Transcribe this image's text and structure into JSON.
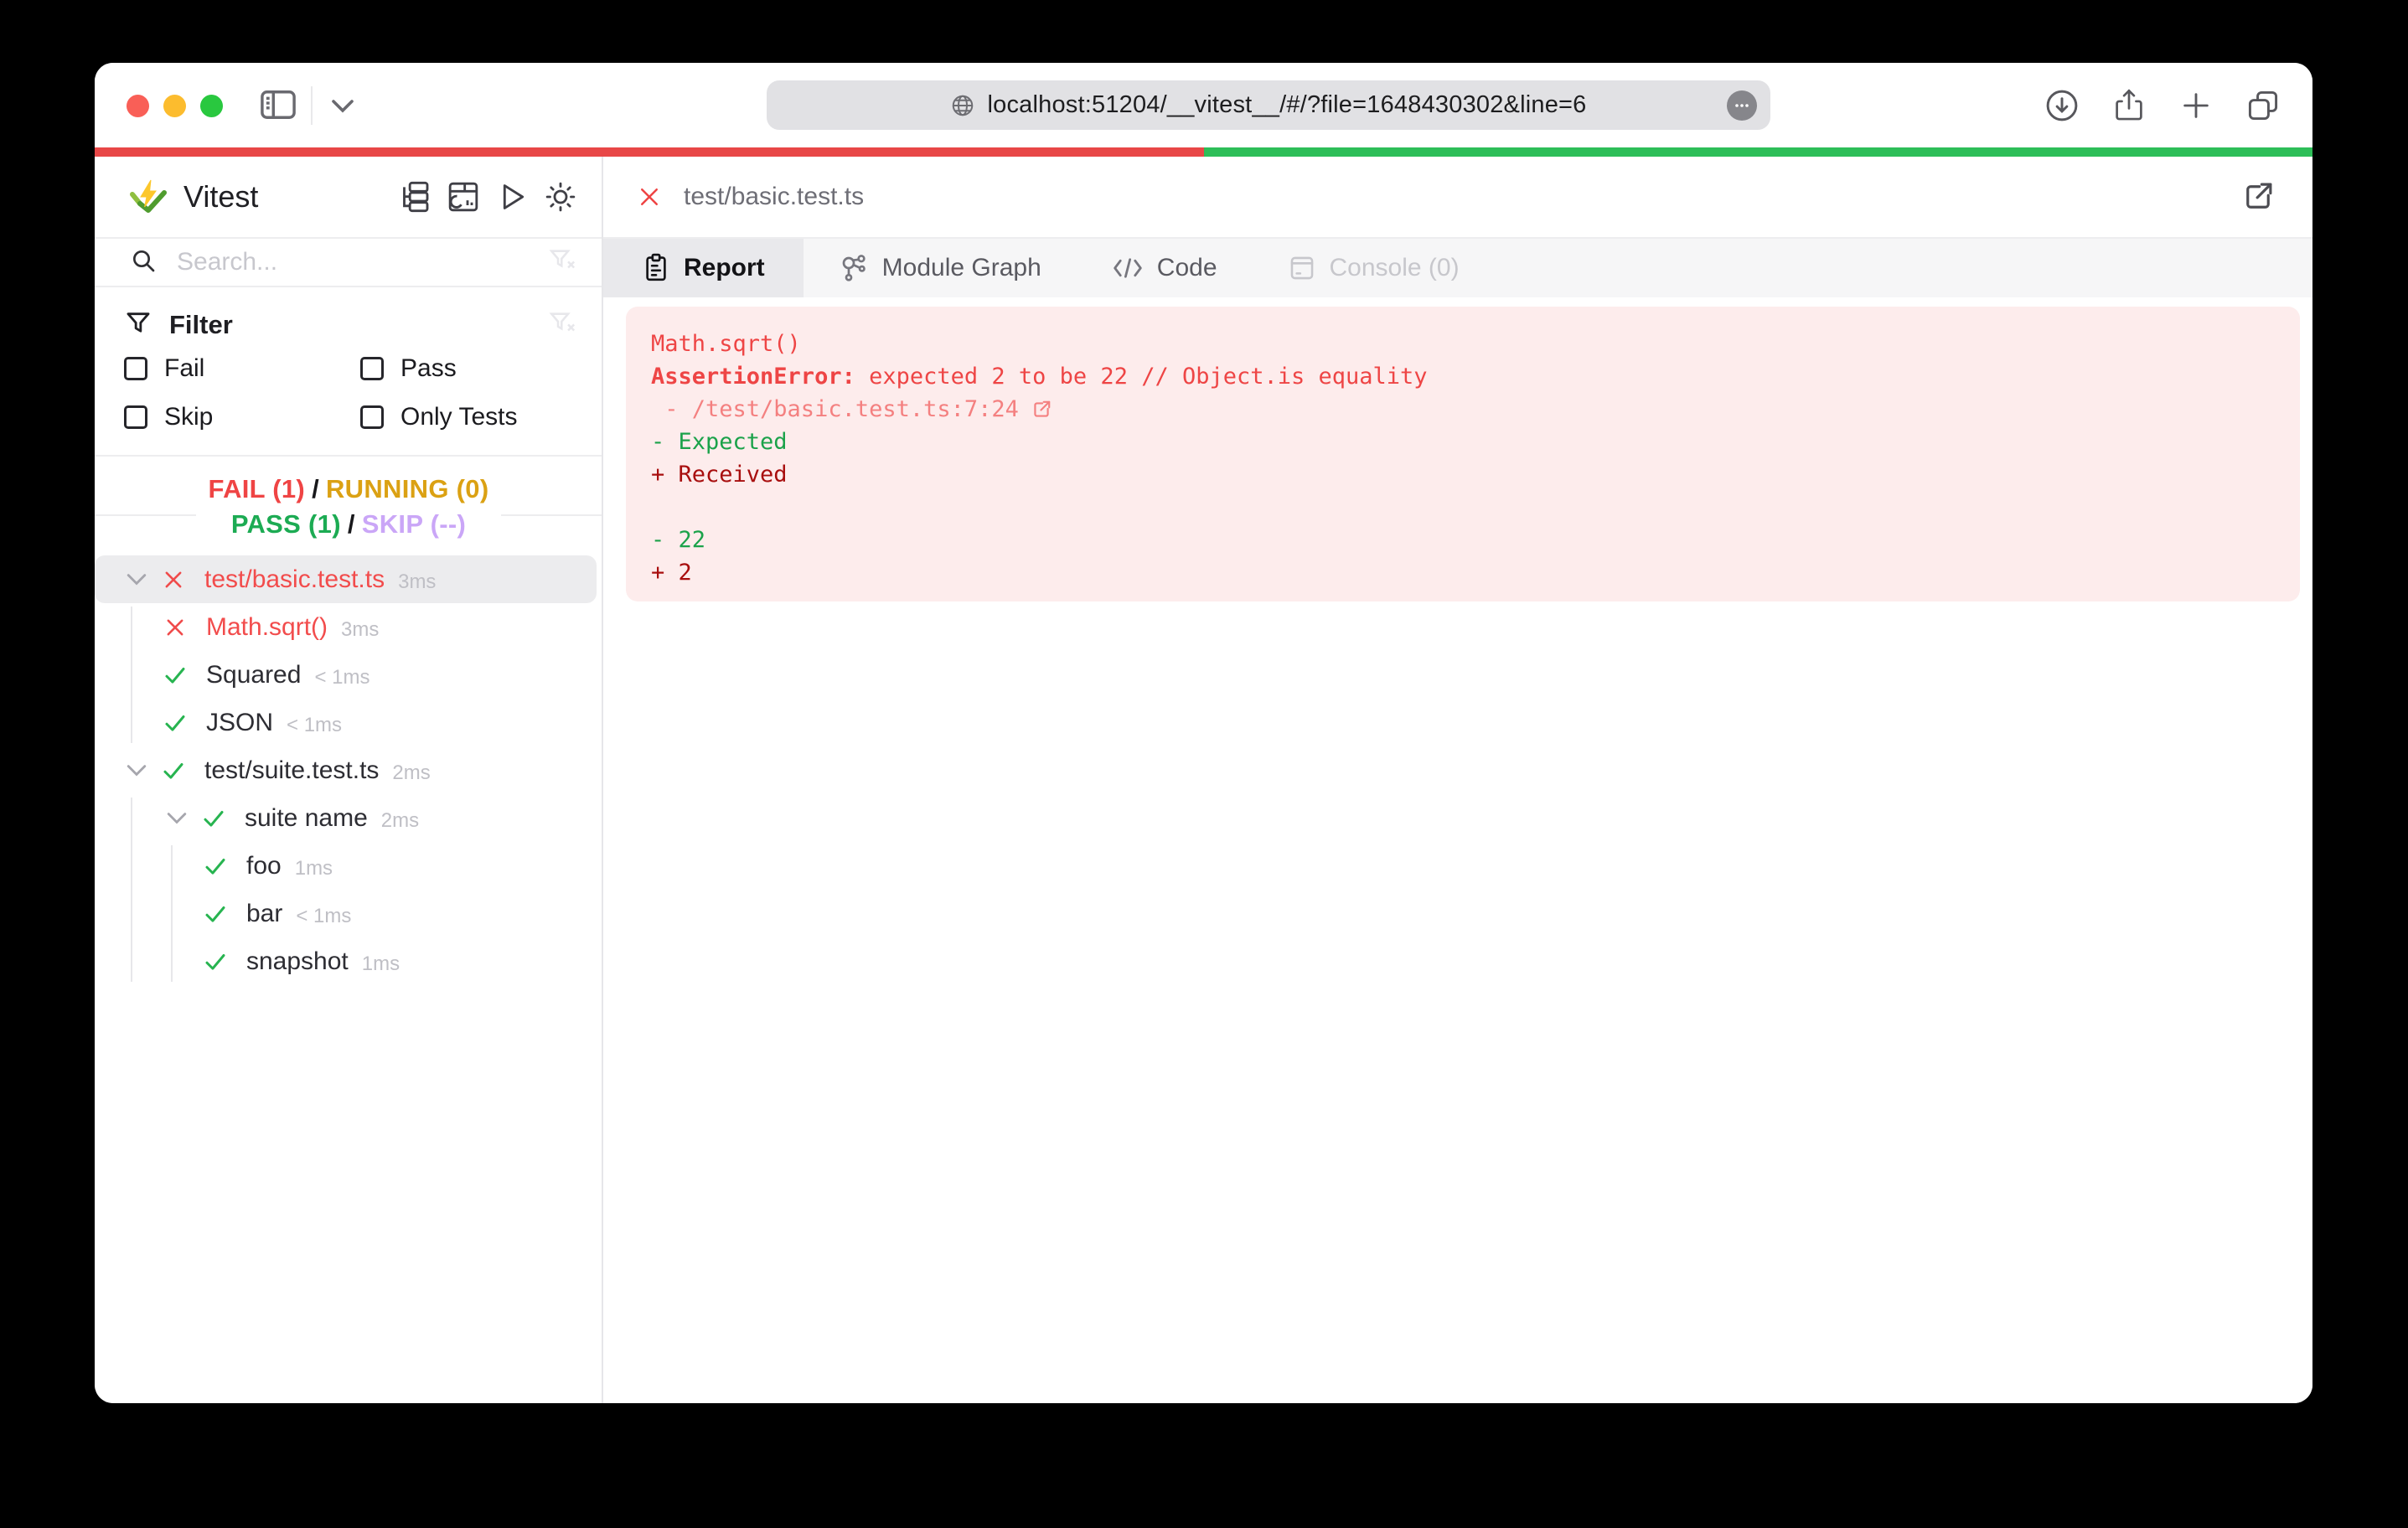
{
  "browser": {
    "url": "localhost:51204/__vitest__/#/?file=1648430302&line=6"
  },
  "progress": {
    "fail_color": "#e84747",
    "pass_color": "#2dbe58",
    "fail_percent": 50,
    "pass_percent": 50
  },
  "sidebar": {
    "app_title": "Vitest",
    "search_placeholder": "Search...",
    "filter": {
      "title": "Filter",
      "options": {
        "fail": "Fail",
        "pass": "Pass",
        "skip": "Skip",
        "only": "Only Tests"
      }
    },
    "status": {
      "fail": "FAIL (1)",
      "running": "RUNNING (0)",
      "pass": "PASS (1)",
      "skip": "SKIP (--)",
      "sep": "/"
    },
    "tree": [
      {
        "label": "test/basic.test.ts",
        "duration": "3ms",
        "state": "fail",
        "depth": 0,
        "expanded": true,
        "selected": true
      },
      {
        "label": "Math.sqrt()",
        "duration": "3ms",
        "state": "fail",
        "depth": 1
      },
      {
        "label": "Squared",
        "duration": "< 1ms",
        "state": "pass",
        "depth": 1
      },
      {
        "label": "JSON",
        "duration": "< 1ms",
        "state": "pass",
        "depth": 1
      },
      {
        "label": "test/suite.test.ts",
        "duration": "2ms",
        "state": "pass",
        "depth": 0,
        "expanded": true
      },
      {
        "label": "suite name",
        "duration": "2ms",
        "state": "pass",
        "depth": 1,
        "expanded": true
      },
      {
        "label": "foo",
        "duration": "1ms",
        "state": "pass",
        "depth": 2
      },
      {
        "label": "bar",
        "duration": "< 1ms",
        "state": "pass",
        "depth": 2
      },
      {
        "label": "snapshot",
        "duration": "1ms",
        "state": "pass",
        "depth": 2
      }
    ]
  },
  "main": {
    "file_tab_label": "test/basic.test.ts",
    "tabs": {
      "report": "Report",
      "module_graph": "Module Graph",
      "code": "Code",
      "console": "Console (0)"
    },
    "report": {
      "test_name": "Math.sqrt()",
      "error_name": "AssertionError: ",
      "error_message": "expected 2 to be 22 // Object.is equality",
      "stack": " - /test/basic.test.ts:7:24",
      "diff_expected_label": "- Expected",
      "diff_received_label": "+ Received",
      "diff_expected_value": "- 22",
      "diff_received_value": "+ 2"
    }
  }
}
